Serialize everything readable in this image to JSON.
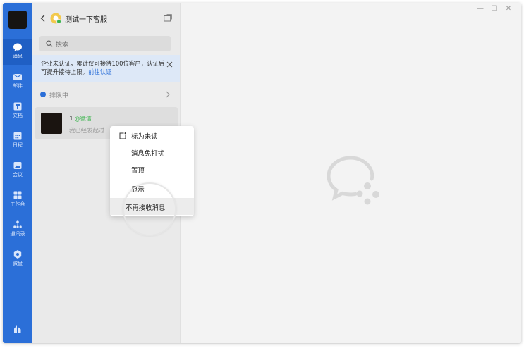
{
  "colors": {
    "accent": "#2b6fd8",
    "wechat_green": "#3ab44c"
  },
  "rail": {
    "items": [
      {
        "label": "消息",
        "icon": "chat-bubble-icon"
      },
      {
        "label": "邮件",
        "icon": "mail-icon"
      },
      {
        "label": "文档",
        "icon": "document-icon"
      },
      {
        "label": "日程",
        "icon": "calendar-icon"
      },
      {
        "label": "会议",
        "icon": "meeting-icon"
      },
      {
        "label": "工作台",
        "icon": "workbench-icon"
      },
      {
        "label": "通讯录",
        "icon": "contacts-icon"
      },
      {
        "label": "微盘",
        "icon": "drive-icon"
      }
    ]
  },
  "header": {
    "title": "测试一下客服"
  },
  "search": {
    "placeholder": "搜索"
  },
  "notice": {
    "text": "企业未认证，累计仅可接待100位客户，认证后可提升接待上限。",
    "link": "前往认证"
  },
  "queue": {
    "label": "排队中"
  },
  "conversation": {
    "name": "1",
    "source": "@微信",
    "preview": "我已经发起过"
  },
  "context_menu": {
    "items": [
      "标为未读",
      "消息免打扰",
      "置顶",
      "显示",
      "不再接收消息"
    ]
  },
  "window_controls": {
    "minimize": "—",
    "maximize": "☐",
    "close": "✕"
  }
}
